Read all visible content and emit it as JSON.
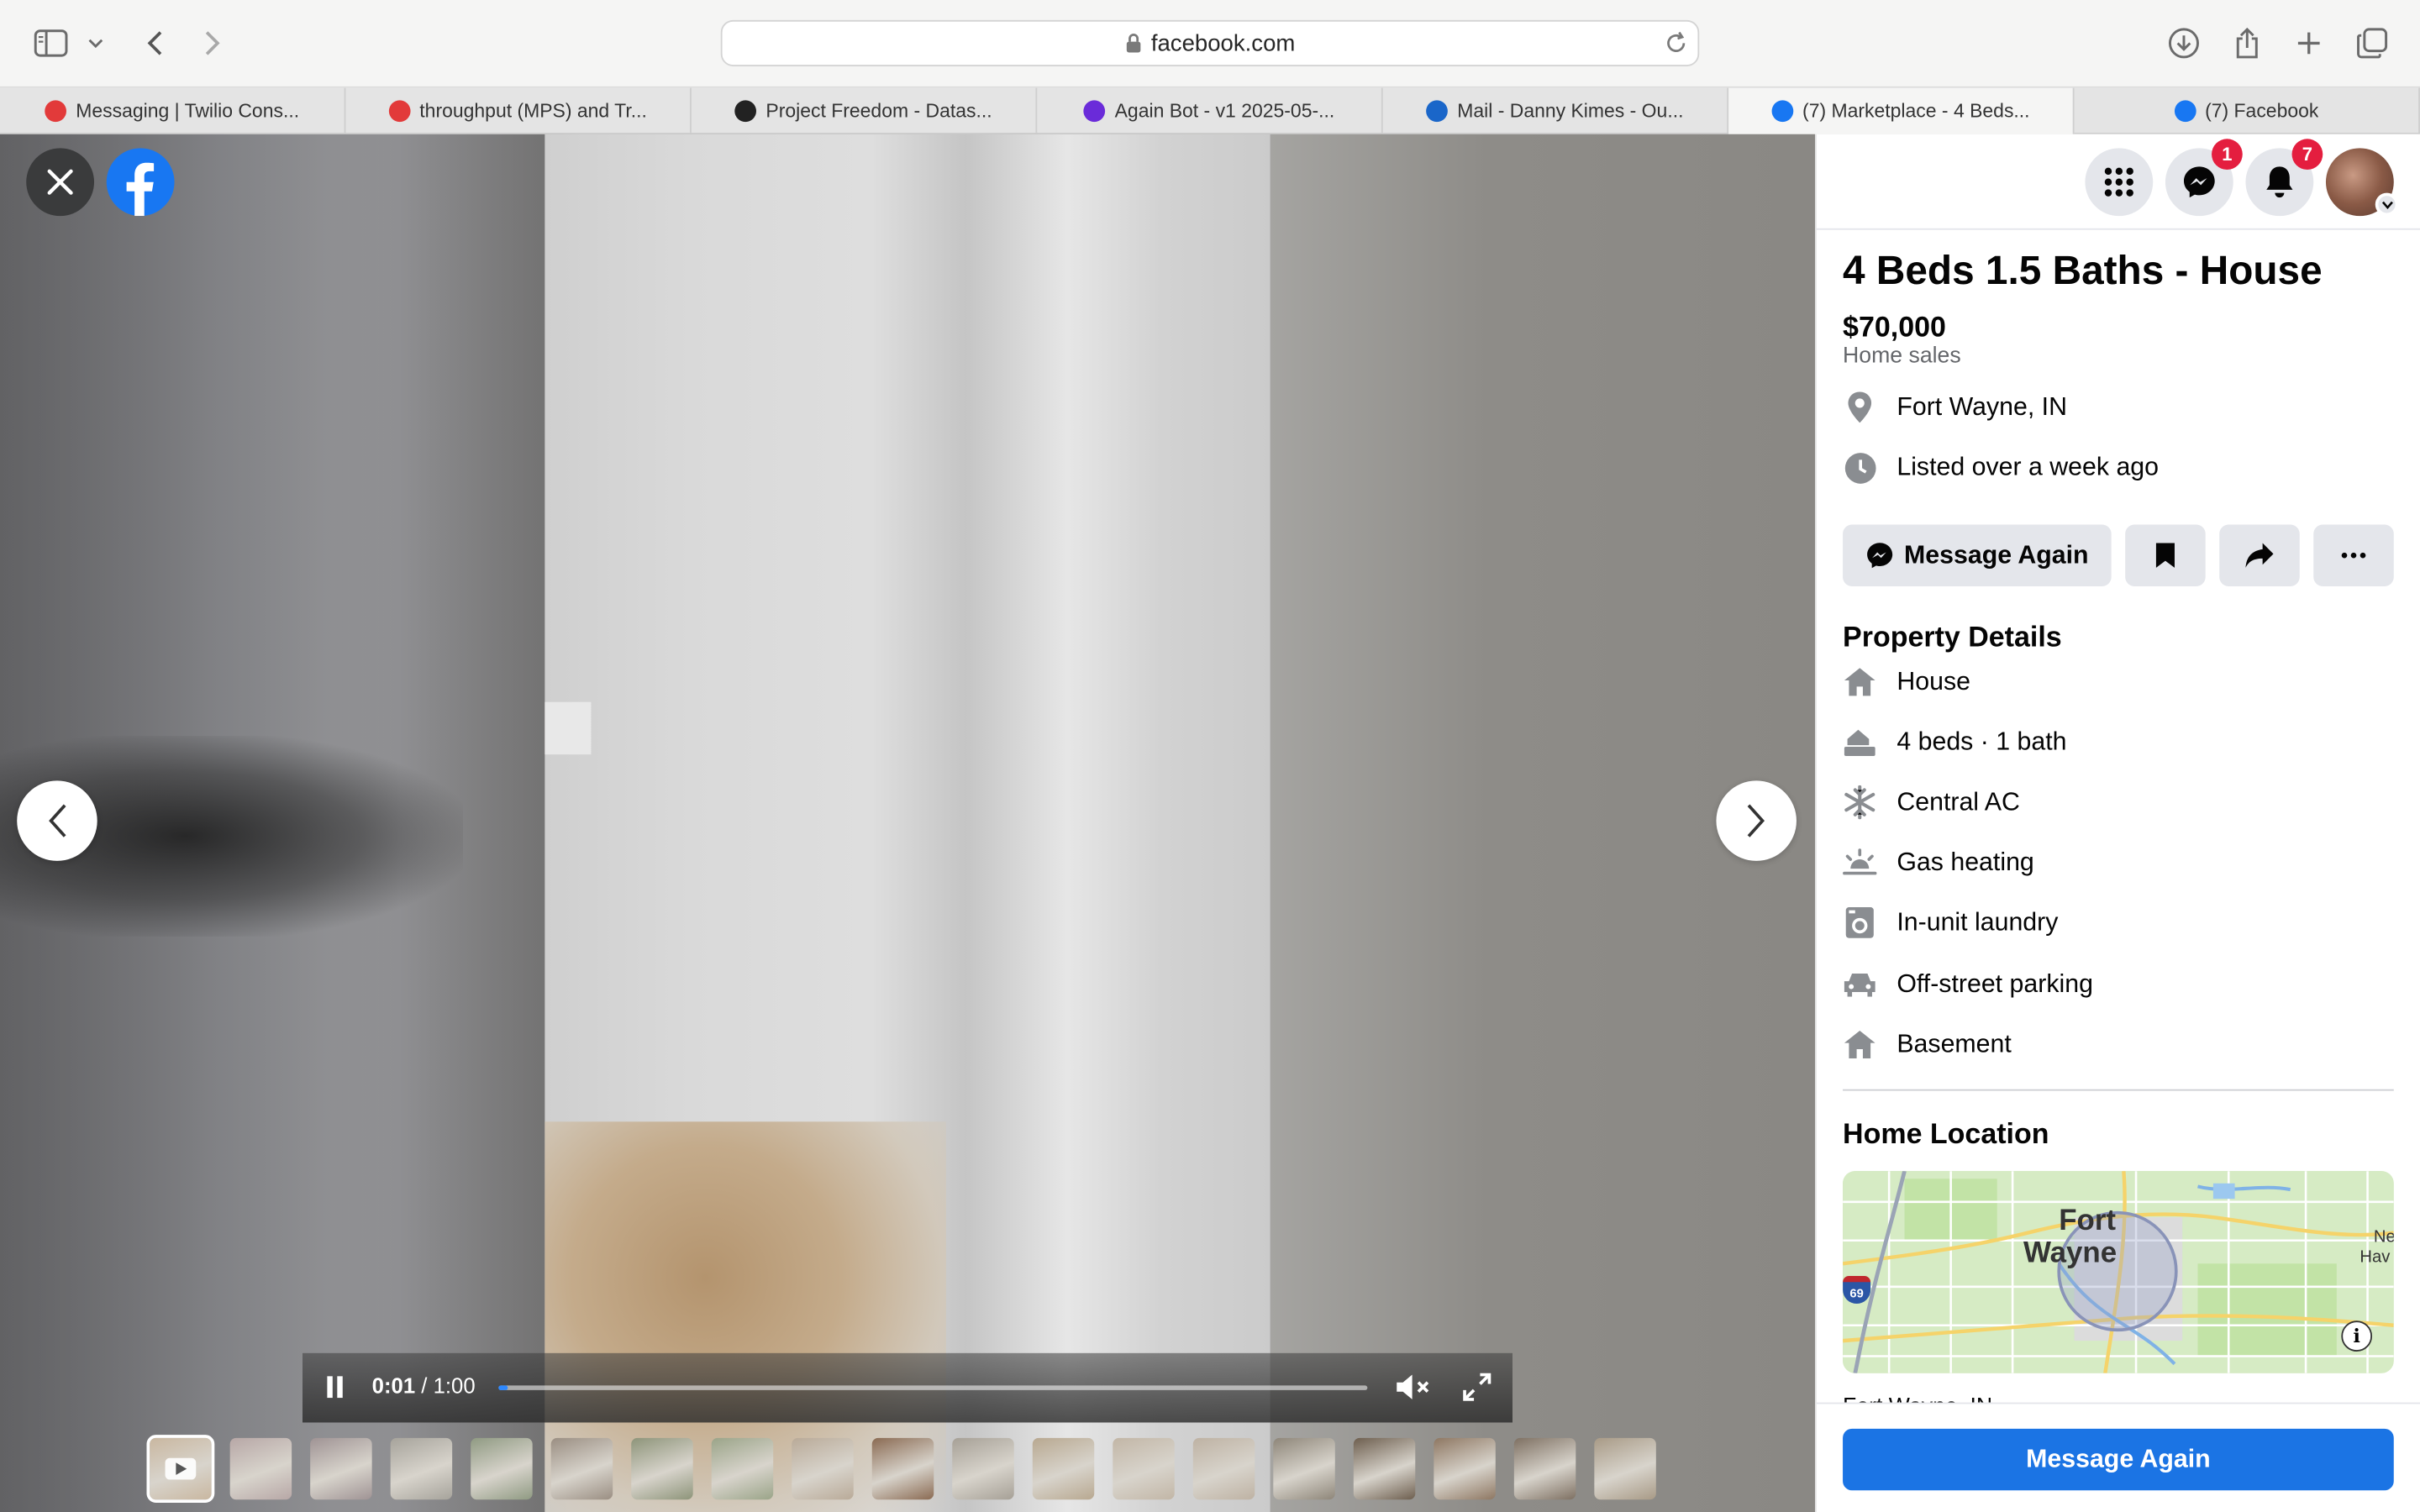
{
  "browser": {
    "url": "facebook.com",
    "tabs": [
      {
        "label": "Messaging | Twilio Cons...",
        "favicon_color": "#e23a3a",
        "active": false
      },
      {
        "label": "throughput (MPS) and Tr...",
        "favicon_color": "#e23a3a",
        "active": false
      },
      {
        "label": "Project Freedom - Datas...",
        "favicon_color": "#222222",
        "active": false
      },
      {
        "label": "Again Bot - v1 2025-05-...",
        "favicon_color": "#6a2bd9",
        "active": false
      },
      {
        "label": "Mail - Danny Kimes - Ou...",
        "favicon_color": "#1a66c9",
        "active": false
      },
      {
        "label": "(7) Marketplace - 4 Beds...",
        "favicon_color": "#1877f2",
        "active": true
      },
      {
        "label": "(7) Facebook",
        "favicon_color": "#1877f2",
        "active": false
      }
    ]
  },
  "video": {
    "current_time": "0:01",
    "separator": " / ",
    "duration": "1:00",
    "progress_fraction": 0.01,
    "thumbnail_count": 19
  },
  "header": {
    "messenger_badge": "1",
    "notifications_badge": "7"
  },
  "listing": {
    "title": "4 Beds 1.5 Baths - House",
    "price": "$70,000",
    "category": "Home sales",
    "location": "Fort Wayne, IN",
    "listed": "Listed over a week ago",
    "message_button": "Message Again"
  },
  "property_details": {
    "heading": "Property Details",
    "items": [
      {
        "icon": "house-icon",
        "label": "House"
      },
      {
        "icon": "beds-icon",
        "label": "4 beds · 1 bath"
      },
      {
        "icon": "snowflake-icon",
        "label": "Central AC"
      },
      {
        "icon": "heating-icon",
        "label": "Gas heating"
      },
      {
        "icon": "laundry-icon",
        "label": "In-unit laundry"
      },
      {
        "icon": "car-icon",
        "label": "Off-street parking"
      },
      {
        "icon": "house-icon",
        "label": "Basement"
      }
    ]
  },
  "home_location": {
    "heading": "Home Location",
    "map_city_line1": "Fort",
    "map_city_line2": "Wayne",
    "map_nh_line1": "Ne",
    "map_nh_line2": "Hav",
    "interstate": "69",
    "address_partial": "Fort Wayne, IN"
  },
  "footer": {
    "primary_button": "Message Again"
  },
  "colors": {
    "facebook_blue": "#1877f2",
    "primary_button": "#1b74e4",
    "badge_red": "#e41e3f"
  }
}
